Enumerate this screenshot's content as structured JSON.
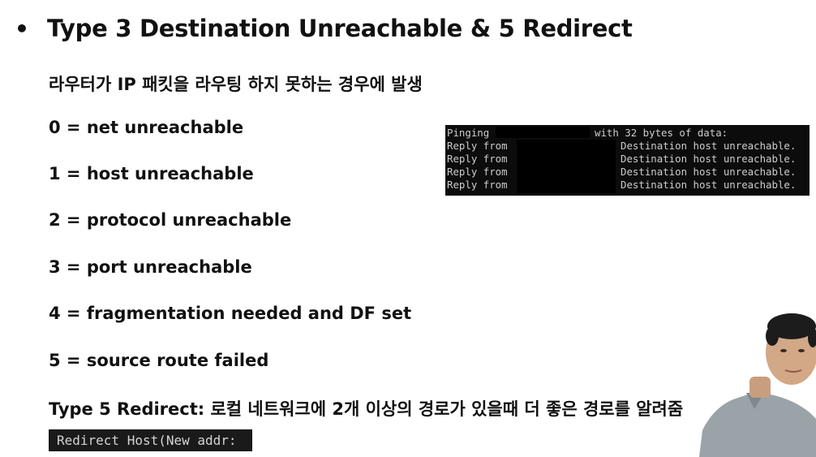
{
  "slide": {
    "bullet": "•",
    "title": "Type 3 Destination Unreachable &  5 Redirect",
    "subtitle": "라우터가 IP 패킷을 라우팅 하지 못하는 경우에 발생",
    "codes": [
      "0 = net unreachable",
      "1 = host unreachable",
      "2 = protocol unreachable",
      "3 = port unreachable",
      "4 = fragmentation needed and DF set",
      "5 = source route failed"
    ],
    "redirect_description": "Type 5 Redirect: 로컬 네트워크에 2개 이상의 경로가 있을때 더 좋은 경로를 알려줌"
  },
  "terminal": {
    "ping_label": "Pinging",
    "ping_suffix": "with 32 bytes of data:",
    "reply_label": "Reply from",
    "reply_message": "Destination host unreachable.",
    "reply_count": 4
  },
  "redirect_output": {
    "text": "Redirect Host(New addr:"
  },
  "colors": {
    "background": "#ffffff",
    "text": "#111111",
    "terminal_bg": "#0c0c0c",
    "terminal_text": "#cccccc"
  }
}
